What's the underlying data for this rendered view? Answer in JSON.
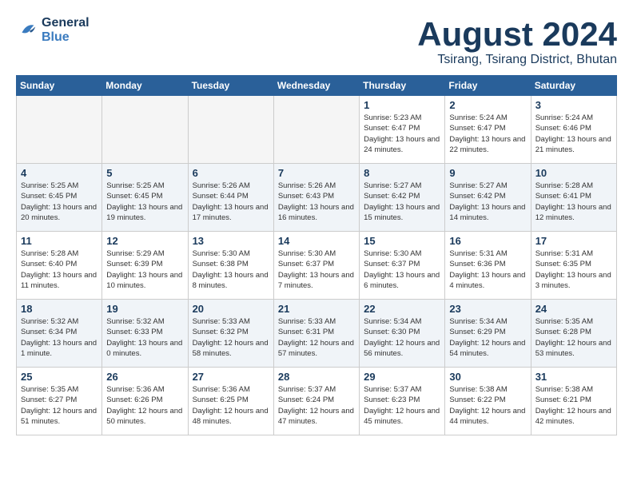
{
  "logo": {
    "line1": "General",
    "line2": "Blue"
  },
  "title": "August 2024",
  "subtitle": "Tsirang, Tsirang District, Bhutan",
  "days_of_week": [
    "Sunday",
    "Monday",
    "Tuesday",
    "Wednesday",
    "Thursday",
    "Friday",
    "Saturday"
  ],
  "weeks": [
    [
      {
        "day": "",
        "empty": true
      },
      {
        "day": "",
        "empty": true
      },
      {
        "day": "",
        "empty": true
      },
      {
        "day": "",
        "empty": true
      },
      {
        "day": "1",
        "sunrise": "5:23 AM",
        "sunset": "6:47 PM",
        "daylight": "13 hours and 24 minutes."
      },
      {
        "day": "2",
        "sunrise": "5:24 AM",
        "sunset": "6:47 PM",
        "daylight": "13 hours and 22 minutes."
      },
      {
        "day": "3",
        "sunrise": "5:24 AM",
        "sunset": "6:46 PM",
        "daylight": "13 hours and 21 minutes."
      }
    ],
    [
      {
        "day": "4",
        "sunrise": "5:25 AM",
        "sunset": "6:45 PM",
        "daylight": "13 hours and 20 minutes."
      },
      {
        "day": "5",
        "sunrise": "5:25 AM",
        "sunset": "6:45 PM",
        "daylight": "13 hours and 19 minutes."
      },
      {
        "day": "6",
        "sunrise": "5:26 AM",
        "sunset": "6:44 PM",
        "daylight": "13 hours and 17 minutes."
      },
      {
        "day": "7",
        "sunrise": "5:26 AM",
        "sunset": "6:43 PM",
        "daylight": "13 hours and 16 minutes."
      },
      {
        "day": "8",
        "sunrise": "5:27 AM",
        "sunset": "6:42 PM",
        "daylight": "13 hours and 15 minutes."
      },
      {
        "day": "9",
        "sunrise": "5:27 AM",
        "sunset": "6:42 PM",
        "daylight": "13 hours and 14 minutes."
      },
      {
        "day": "10",
        "sunrise": "5:28 AM",
        "sunset": "6:41 PM",
        "daylight": "13 hours and 12 minutes."
      }
    ],
    [
      {
        "day": "11",
        "sunrise": "5:28 AM",
        "sunset": "6:40 PM",
        "daylight": "13 hours and 11 minutes."
      },
      {
        "day": "12",
        "sunrise": "5:29 AM",
        "sunset": "6:39 PM",
        "daylight": "13 hours and 10 minutes."
      },
      {
        "day": "13",
        "sunrise": "5:30 AM",
        "sunset": "6:38 PM",
        "daylight": "13 hours and 8 minutes."
      },
      {
        "day": "14",
        "sunrise": "5:30 AM",
        "sunset": "6:37 PM",
        "daylight": "13 hours and 7 minutes."
      },
      {
        "day": "15",
        "sunrise": "5:30 AM",
        "sunset": "6:37 PM",
        "daylight": "13 hours and 6 minutes."
      },
      {
        "day": "16",
        "sunrise": "5:31 AM",
        "sunset": "6:36 PM",
        "daylight": "13 hours and 4 minutes."
      },
      {
        "day": "17",
        "sunrise": "5:31 AM",
        "sunset": "6:35 PM",
        "daylight": "13 hours and 3 minutes."
      }
    ],
    [
      {
        "day": "18",
        "sunrise": "5:32 AM",
        "sunset": "6:34 PM",
        "daylight": "13 hours and 1 minute."
      },
      {
        "day": "19",
        "sunrise": "5:32 AM",
        "sunset": "6:33 PM",
        "daylight": "13 hours and 0 minutes."
      },
      {
        "day": "20",
        "sunrise": "5:33 AM",
        "sunset": "6:32 PM",
        "daylight": "12 hours and 58 minutes."
      },
      {
        "day": "21",
        "sunrise": "5:33 AM",
        "sunset": "6:31 PM",
        "daylight": "12 hours and 57 minutes."
      },
      {
        "day": "22",
        "sunrise": "5:34 AM",
        "sunset": "6:30 PM",
        "daylight": "12 hours and 56 minutes."
      },
      {
        "day": "23",
        "sunrise": "5:34 AM",
        "sunset": "6:29 PM",
        "daylight": "12 hours and 54 minutes."
      },
      {
        "day": "24",
        "sunrise": "5:35 AM",
        "sunset": "6:28 PM",
        "daylight": "12 hours and 53 minutes."
      }
    ],
    [
      {
        "day": "25",
        "sunrise": "5:35 AM",
        "sunset": "6:27 PM",
        "daylight": "12 hours and 51 minutes."
      },
      {
        "day": "26",
        "sunrise": "5:36 AM",
        "sunset": "6:26 PM",
        "daylight": "12 hours and 50 minutes."
      },
      {
        "day": "27",
        "sunrise": "5:36 AM",
        "sunset": "6:25 PM",
        "daylight": "12 hours and 48 minutes."
      },
      {
        "day": "28",
        "sunrise": "5:37 AM",
        "sunset": "6:24 PM",
        "daylight": "12 hours and 47 minutes."
      },
      {
        "day": "29",
        "sunrise": "5:37 AM",
        "sunset": "6:23 PM",
        "daylight": "12 hours and 45 minutes."
      },
      {
        "day": "30",
        "sunrise": "5:38 AM",
        "sunset": "6:22 PM",
        "daylight": "12 hours and 44 minutes."
      },
      {
        "day": "31",
        "sunrise": "5:38 AM",
        "sunset": "6:21 PM",
        "daylight": "12 hours and 42 minutes."
      }
    ]
  ]
}
